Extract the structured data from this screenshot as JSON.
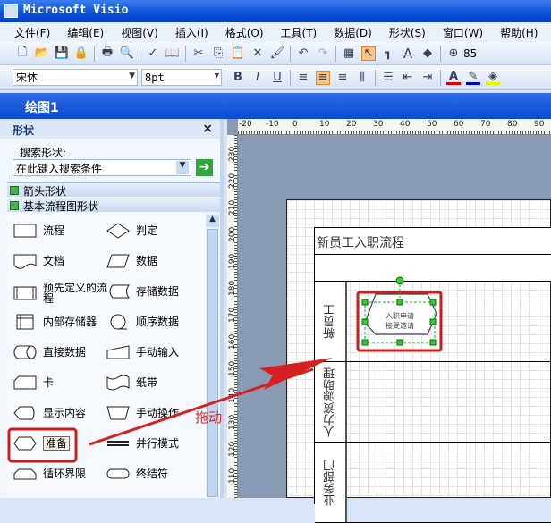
{
  "app": {
    "title": "Microsoft Visio"
  },
  "menu": [
    "文件(F)",
    "编辑(E)",
    "视图(V)",
    "插入(I)",
    "格式(O)",
    "工具(T)",
    "数据(D)",
    "形状(S)",
    "窗口(W)",
    "帮助(H)"
  ],
  "toolbar": {
    "zoom": "85",
    "font": "宋体",
    "size": "8pt"
  },
  "document": {
    "title": "绘图1"
  },
  "shapes_panel": {
    "title": "形状",
    "close": "×",
    "search_label": "搜索形状:",
    "search_placeholder": "在此键入搜索条件",
    "categories": [
      "箭头形状",
      "基本流程图形状"
    ],
    "shapes": [
      "流程",
      "判定",
      "文档",
      "数据",
      "预先定义的流程",
      "存储数据",
      "内部存储器",
      "顺序数据",
      "直接数据",
      "手动输入",
      "卡",
      "纸带",
      "显示内容",
      "手动操作",
      "准备",
      "并行模式",
      "循环界限",
      "终结符"
    ]
  },
  "ruler": {
    "h": [
      "-20",
      "-10",
      "0",
      "10",
      "20",
      "30",
      "40",
      "50",
      "60",
      "70",
      "80",
      "90"
    ],
    "v": [
      "230",
      "220",
      "210",
      "200",
      "190",
      "180",
      "170",
      "160",
      "150",
      "140",
      "130",
      "120",
      "110"
    ]
  },
  "diagram": {
    "pool_title": "新员工入职流程",
    "lanes": [
      "新员工",
      "人力资源助理",
      "业务部门"
    ],
    "shape_text": [
      "入职申请",
      "接受邀请"
    ]
  },
  "annotation": {
    "text": "拖动",
    "color": "#e02020"
  }
}
